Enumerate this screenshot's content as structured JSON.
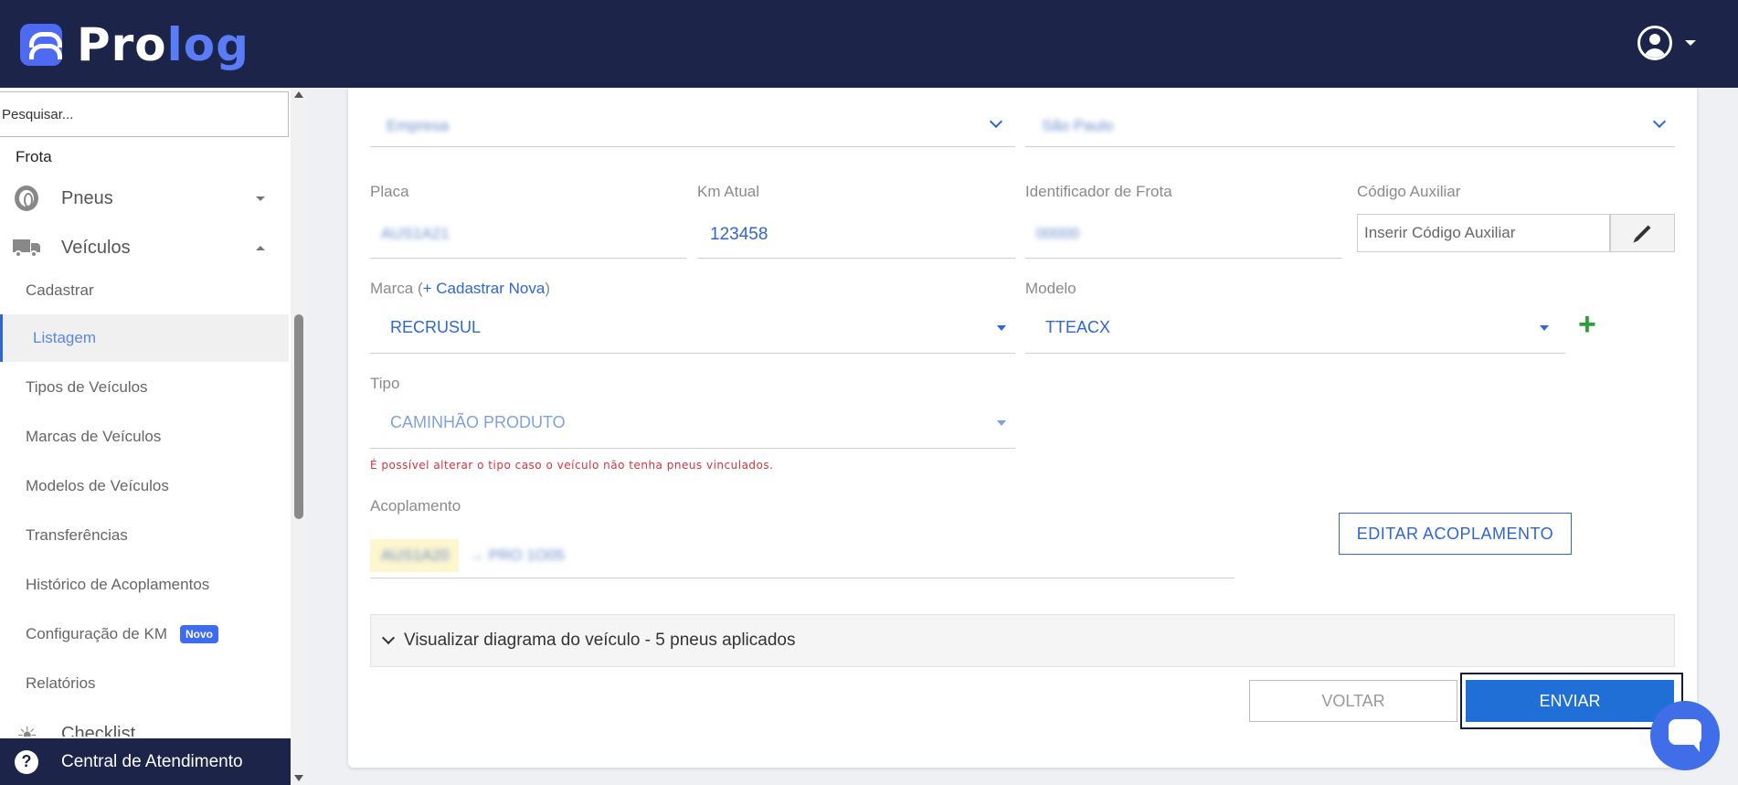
{
  "app": {
    "logo_part1": "Pro",
    "logo_part2": "log"
  },
  "sidebar": {
    "search_placeholder": "Pesquisar...",
    "section": "Frota",
    "groups": {
      "pneus": "Pneus",
      "veiculos": "Veículos",
      "checklist": "Checklist"
    },
    "items": [
      {
        "label": "Cadastrar"
      },
      {
        "label": "Listagem",
        "active": true
      },
      {
        "label": "Tipos de Veículos"
      },
      {
        "label": "Marcas de Veículos"
      },
      {
        "label": "Modelos de Veículos"
      },
      {
        "label": "Transferências"
      },
      {
        "label": "Histórico de Acoplamentos"
      },
      {
        "label": "Configuração de KM",
        "badge": "Novo"
      },
      {
        "label": "Relatórios"
      }
    ],
    "support": "Central de Atendimento"
  },
  "form": {
    "empresa_value": "Empresa",
    "regional_value": "São Paulo",
    "placa": {
      "label": "Placa",
      "value": "AUS1A21"
    },
    "km": {
      "label": "Km Atual",
      "value": "123458"
    },
    "identificador": {
      "label": "Identificador de Frota",
      "value": "00000"
    },
    "codigo": {
      "label": "Código Auxiliar",
      "placeholder": "Inserir Código Auxiliar"
    },
    "marca": {
      "label_prefix": "Marca (",
      "link": "+ Cadastrar Nova",
      "label_suffix": ")",
      "value": "RECRUSUL"
    },
    "modelo": {
      "label": "Modelo",
      "value": "TTEACX"
    },
    "tipo": {
      "label": "Tipo",
      "value": "CAMINHÃO PRODUTO",
      "hint": "É possível alterar o tipo caso o veículo não tenha pneus vinculados."
    },
    "acoplamento": {
      "label": "Acoplamento",
      "chip": "AUS1A20",
      "text": "→ PRO 1O05",
      "button": "EDITAR ACOPLAMENTO"
    },
    "accordion": "Visualizar diagrama do veículo - 5 pneus aplicados",
    "voltar": "VOLTAR",
    "enviar": "ENVIAR"
  },
  "colors": {
    "topbar": "#1d2449",
    "accent": "#2f66d0",
    "primary_button": "#1f6fd6",
    "hint_red": "#d9323a",
    "add_green": "#2aa137"
  }
}
